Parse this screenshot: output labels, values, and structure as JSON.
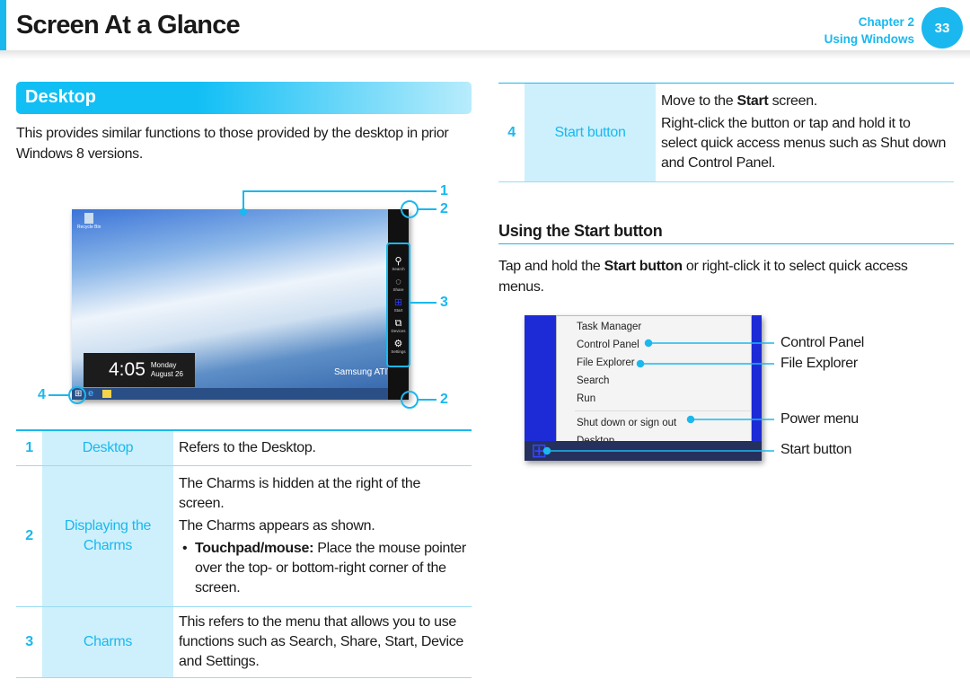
{
  "header": {
    "title": "Screen At a Glance",
    "chapter": "Chapter 2",
    "chapter_title": "Using Windows",
    "page_number": "33"
  },
  "section": {
    "title": "Desktop",
    "intro": "This provides similar functions to those provided by the desktop in prior Windows 8 versions."
  },
  "desktop_screenshot": {
    "recycle_bin": "Recycle Bin",
    "time": "4:05",
    "day": "Monday",
    "date": "August 26",
    "brand": "Samsung ATIV",
    "charms": [
      "Search",
      "Share",
      "Start",
      "Devices",
      "Settings"
    ],
    "callouts": [
      "1",
      "2",
      "3",
      "4",
      "2"
    ]
  },
  "left_table": {
    "rows": [
      {
        "num": "1",
        "label": "Desktop",
        "desc": [
          "Refers to the Desktop."
        ]
      },
      {
        "num": "2",
        "label": "Displaying the Charms",
        "desc": [
          "The Charms is hidden at the right of the screen.",
          "The Charms appears as shown."
        ],
        "bullet_bold": "Touchpad/mouse:",
        "bullet_text": " Place the mouse pointer over the top- or bottom-right corner of the screen."
      },
      {
        "num": "3",
        "label": "Charms",
        "desc": [
          "This refers to the menu that allows you to use functions such as Search, Share, Start, Device and Settings."
        ]
      }
    ]
  },
  "right_table": {
    "num": "4",
    "label": "Start button",
    "line1_pre": "Move to the ",
    "line1_bold": "Start",
    "line1_post": " screen.",
    "line2": "Right-click the button or tap and hold it to select quick access menus such as Shut down and Control Panel."
  },
  "start_section": {
    "title": "Using the Start button",
    "text_pre": "Tap and hold the ",
    "text_bold": "Start button",
    "text_post": " or right-click it to select quick access menus.",
    "menu_items": [
      "Task Manager",
      "Control Panel",
      "File Explorer",
      "Search",
      "Run",
      "Shut down or sign out",
      "Desktop"
    ],
    "callouts": [
      "Control Panel",
      "File Explorer",
      "Power menu",
      "Start button"
    ]
  },
  "colors": {
    "accent": "#1ab8ee",
    "label_bg": "#cdf0fc"
  }
}
